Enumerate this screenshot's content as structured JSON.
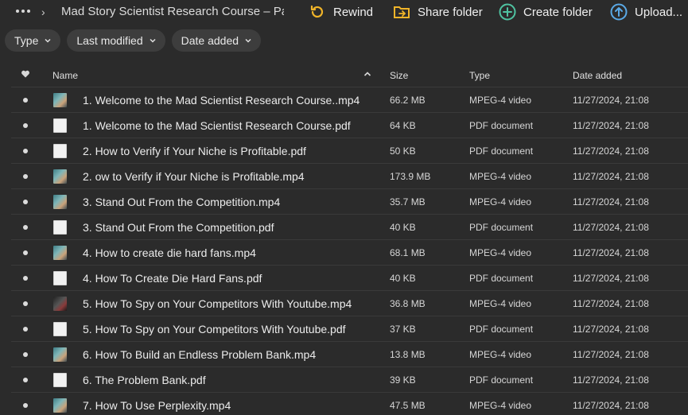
{
  "toolbar": {
    "breadcrumb": "Mad Story Scientist Research Course – Par...",
    "rewind_label": "Rewind",
    "share_folder_label": "Share folder",
    "create_folder_label": "Create folder",
    "upload_label": "Upload..."
  },
  "filters": {
    "type_label": "Type",
    "last_modified_label": "Last modified",
    "date_added_label": "Date added"
  },
  "columns": {
    "name": "Name",
    "size": "Size",
    "type": "Type",
    "date_added": "Date added"
  },
  "colors": {
    "background": "#2b2b2b",
    "rewind_accent": "#f0b429",
    "share_accent": "#f0b429",
    "create_accent": "#4fc3a1",
    "upload_accent": "#5aa9e6"
  },
  "files": [
    {
      "name": "1. Welcome to the Mad Scientist Research Course..mp4",
      "size": "66.2 MB",
      "type": "MPEG-4 video",
      "date": "11/27/2024, 21:08",
      "kind": "video"
    },
    {
      "name": "1. Welcome to the Mad Scientist Research Course.pdf",
      "size": "64 KB",
      "type": "PDF document",
      "date": "11/27/2024, 21:08",
      "kind": "pdf"
    },
    {
      "name": "2. How to Verify if Your Niche is Profitable.pdf",
      "size": "50 KB",
      "type": "PDF document",
      "date": "11/27/2024, 21:08",
      "kind": "pdf"
    },
    {
      "name": "2. ow to Verify if Your Niche is Profitable.mp4",
      "size": "173.9 MB",
      "type": "MPEG-4 video",
      "date": "11/27/2024, 21:08",
      "kind": "video"
    },
    {
      "name": "3. Stand Out From the Competition.mp4",
      "size": "35.7 MB",
      "type": "MPEG-4 video",
      "date": "11/27/2024, 21:08",
      "kind": "video"
    },
    {
      "name": "3. Stand Out From the Competition.pdf",
      "size": "40 KB",
      "type": "PDF document",
      "date": "11/27/2024, 21:08",
      "kind": "pdf"
    },
    {
      "name": "4. How to create die hard fans.mp4",
      "size": "68.1 MB",
      "type": "MPEG-4 video",
      "date": "11/27/2024, 21:08",
      "kind": "video"
    },
    {
      "name": "4. How To Create Die Hard Fans.pdf",
      "size": "40 KB",
      "type": "PDF document",
      "date": "11/27/2024, 21:08",
      "kind": "pdf"
    },
    {
      "name": "5. How To Spy on Your Competitors With Youtube.mp4",
      "size": "36.8 MB",
      "type": "MPEG-4 video",
      "date": "11/27/2024, 21:08",
      "kind": "video-dark"
    },
    {
      "name": "5. How To Spy on Your Competitors With Youtube.pdf",
      "size": "37 KB",
      "type": "PDF document",
      "date": "11/27/2024, 21:08",
      "kind": "pdf"
    },
    {
      "name": "6. How To Build an Endless Problem Bank.mp4",
      "size": "13.8 MB",
      "type": "MPEG-4 video",
      "date": "11/27/2024, 21:08",
      "kind": "video"
    },
    {
      "name": "6. The Problem Bank.pdf",
      "size": "39 KB",
      "type": "PDF document",
      "date": "11/27/2024, 21:08",
      "kind": "pdf"
    },
    {
      "name": "7. How To Use Perplexity.mp4",
      "size": "47.5 MB",
      "type": "MPEG-4 video",
      "date": "11/27/2024, 21:08",
      "kind": "video"
    }
  ]
}
